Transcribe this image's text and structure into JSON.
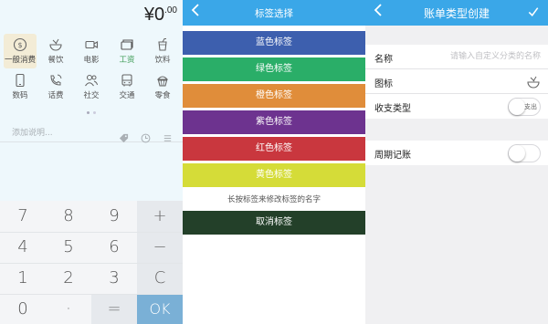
{
  "calculator": {
    "amount_main": "¥0",
    "amount_decimal": ".00",
    "categories": [
      {
        "label": "一般消费",
        "icon": "coin-icon"
      },
      {
        "label": "餐饮",
        "icon": "bowl-icon"
      },
      {
        "label": "电影",
        "icon": "video-camera-icon"
      },
      {
        "label": "工资",
        "icon": "wallet-icon"
      },
      {
        "label": "饮料",
        "icon": "cup-icon"
      },
      {
        "label": "数码",
        "icon": "phone-icon"
      },
      {
        "label": "话费",
        "icon": "phone-call-icon"
      },
      {
        "label": "社交",
        "icon": "people-icon"
      },
      {
        "label": "交通",
        "icon": "bus-icon"
      },
      {
        "label": "零食",
        "icon": "cupcake-icon"
      }
    ],
    "note_placeholder": "添加说明...",
    "keys": [
      [
        "7",
        "8",
        "9",
        "+"
      ],
      [
        "4",
        "5",
        "6",
        "−"
      ],
      [
        "1",
        "2",
        "3",
        "C"
      ],
      [
        "0",
        "·",
        "=",
        "OK"
      ]
    ],
    "colors": {
      "ok": "#7ab0d6",
      "highlight": "#3a9a52"
    }
  },
  "tag_select": {
    "title": "标签选择",
    "tags": [
      {
        "label": "蓝色标签",
        "color": "#3d5fae"
      },
      {
        "label": "绿色标签",
        "color": "#2aae68"
      },
      {
        "label": "橙色标签",
        "color": "#e08d3a"
      },
      {
        "label": "紫色标签",
        "color": "#6d338f"
      },
      {
        "label": "红色标签",
        "color": "#c9373e"
      },
      {
        "label": "黄色标签",
        "color": "#d5dc38"
      }
    ],
    "hint": "长按标签来修改标签的名字",
    "cancel_label": "取消标签",
    "cancel_color": "#234029"
  },
  "create_type": {
    "title": "账单类型创建",
    "name_label": "名称",
    "name_placeholder": "请输入自定义分类的名称",
    "icon_label": "图标",
    "icon_value": "bowl-icon",
    "type_label": "收支类型",
    "type_toggle_text": "支出",
    "recurring_label": "周期记账"
  },
  "nav_color": "#3aa7e8"
}
